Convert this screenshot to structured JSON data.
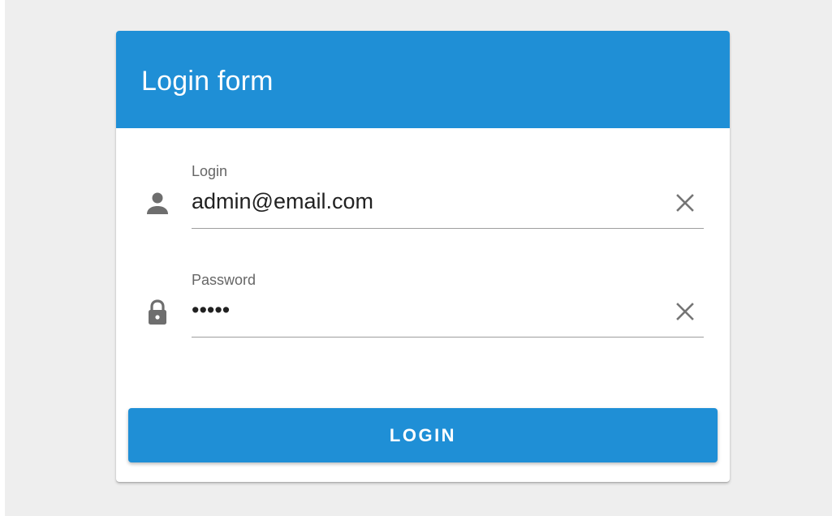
{
  "form": {
    "title": "Login form",
    "header_color": "#1f8fd6"
  },
  "fields": {
    "login": {
      "label": "Login",
      "value": "admin@email.com",
      "icon": "person-icon",
      "clear_icon": "close-icon"
    },
    "password": {
      "label": "Password",
      "value": "•••••",
      "icon": "lock-icon",
      "clear_icon": "close-icon"
    }
  },
  "actions": {
    "submit_label": "LOGIN",
    "button_color": "#1f8fd6"
  }
}
